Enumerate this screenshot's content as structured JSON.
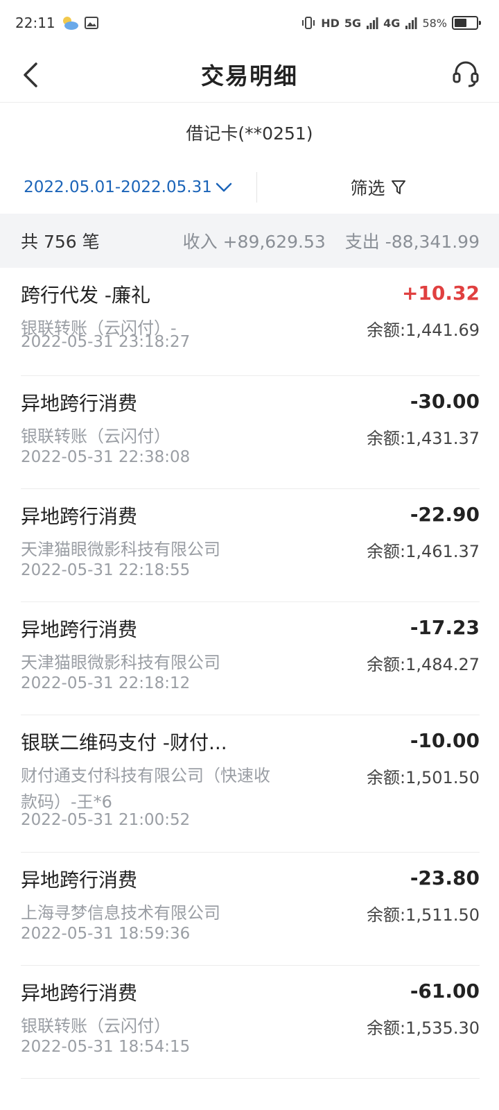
{
  "status_bar": {
    "time": "22:11",
    "weather_icon": "weather-cloud-moon-icon",
    "network_label": "5G",
    "network2_label": "4G",
    "hd_label": "HD",
    "battery_percent": "58%",
    "battery_level": 0.58
  },
  "nav": {
    "title": "交易明细",
    "back_icon": "chevron-left-icon",
    "service_icon": "headset-icon"
  },
  "card": {
    "label": "借记卡(**0251)"
  },
  "filter": {
    "date_range": "2022.05.01-2022.05.31",
    "filter_label": "筛选"
  },
  "summary": {
    "count": "共 756 笔",
    "income": "收入 +89,629.53",
    "expense": "支出 -88,341.99"
  },
  "transactions": [
    {
      "title": "跨行代发 -廉礼",
      "sub": "银联转账（云闪付）-",
      "time": "2022-05-31 23:18:27",
      "amount": "+10.32",
      "balance": "余额:1,441.69",
      "income": true
    },
    {
      "title": "异地跨行消费",
      "sub": "银联转账（云闪付）",
      "time": "2022-05-31 22:38:08",
      "amount": "-30.00",
      "balance": "余额:1,431.37",
      "income": false
    },
    {
      "title": "异地跨行消费",
      "sub": "天津猫眼微影科技有限公司",
      "time": "2022-05-31 22:18:55",
      "amount": "-22.90",
      "balance": "余额:1,461.37",
      "income": false
    },
    {
      "title": "异地跨行消费",
      "sub": "天津猫眼微影科技有限公司",
      "time": "2022-05-31 22:18:12",
      "amount": "-17.23",
      "balance": "余额:1,484.27",
      "income": false
    },
    {
      "title": "银联二维码支付 -财付...",
      "sub": "财付通支付科技有限公司（快速收款码）-王*6",
      "time": "2022-05-31 21:00:52",
      "amount": "-10.00",
      "balance": "余额:1,501.50",
      "income": false
    },
    {
      "title": "异地跨行消费",
      "sub": "上海寻梦信息技术有限公司",
      "time": "2022-05-31 18:59:36",
      "amount": "-23.80",
      "balance": "余额:1,511.50",
      "income": false
    },
    {
      "title": "异地跨行消费",
      "sub": "银联转账（云闪付）",
      "time": "2022-05-31 18:54:15",
      "amount": "-61.00",
      "balance": "余额:1,535.30",
      "income": false
    }
  ]
}
